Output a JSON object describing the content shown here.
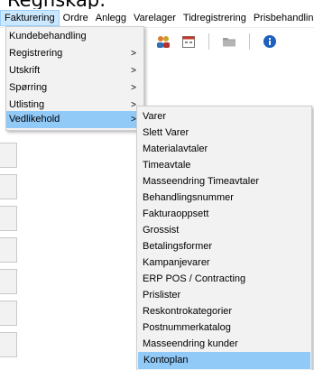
{
  "title_fragment": "Regnskap:",
  "menubar": {
    "items": [
      "Fakturering",
      "Ordre",
      "Anlegg",
      "Varelager",
      "Tidregistrering",
      "Prisbehandling"
    ]
  },
  "toolbar": {
    "icons": [
      "people-icon",
      "calendar-icon",
      "folder-icon",
      "info-icon"
    ]
  },
  "menu_fakturering": {
    "items": [
      {
        "label": "Kundebehandling",
        "submenu": false
      },
      {
        "label": "Registrering",
        "submenu": true,
        "arrow": ">"
      },
      {
        "label": "Utskrift",
        "submenu": true,
        "arrow": ">"
      },
      {
        "label": "Spørring",
        "submenu": true,
        "arrow": ">"
      },
      {
        "label": "Utlisting",
        "submenu": true,
        "arrow": ">"
      },
      {
        "label": "Vedlikehold",
        "submenu": true,
        "arrow": ">",
        "highlighted": true
      }
    ]
  },
  "menu_vedlikehold": {
    "items": [
      "Varer",
      "Slett Varer",
      "Materialavtaler",
      "Timeavtale",
      "Masseendring Timeavtaler",
      "Behandlingsnummer",
      "Fakturaoppsett",
      "Grossist",
      "Betalingsformer",
      "Kampanjevarer",
      "ERP POS / Contracting",
      "Prislister",
      "Reskontrokategorier",
      "Postnummerkatalog",
      "Masseendring kunder",
      "Kontoplan"
    ],
    "highlighted": "Kontoplan"
  },
  "colors": {
    "menu_bg": "#f2f2f2",
    "highlight": "#91c9f7",
    "menubar_active": "#cce8ff"
  }
}
